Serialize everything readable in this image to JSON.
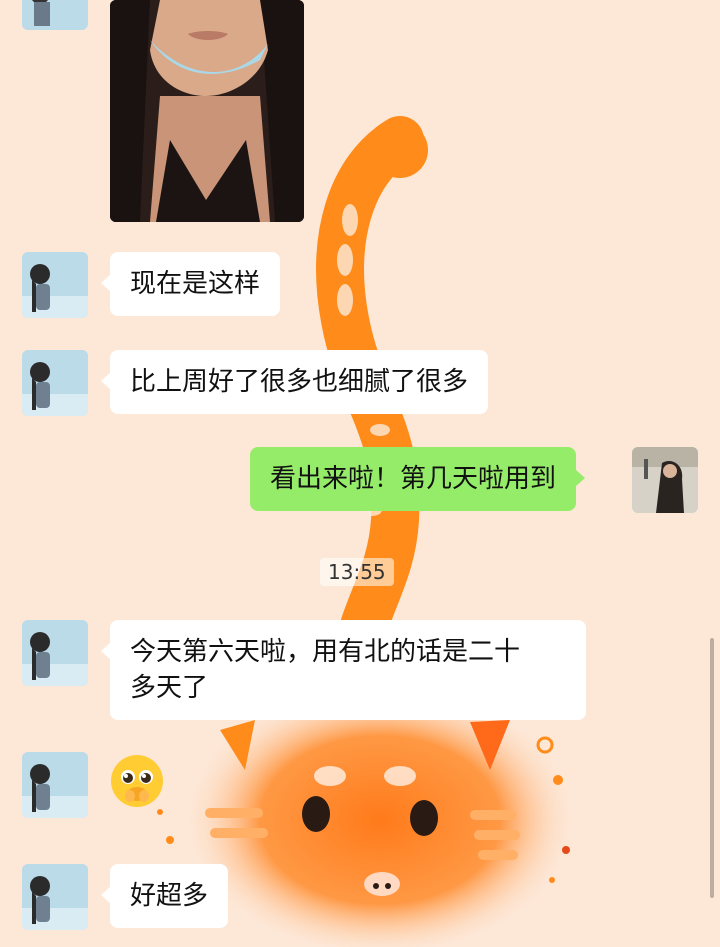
{
  "colors": {
    "background": "#fde8d8",
    "incoming_bubble": "#ffffff",
    "outgoing_bubble": "#95ec69",
    "wallpaper_accent": "#ff8c1a"
  },
  "messages": [
    {
      "type": "image",
      "direction": "incoming",
      "description": "selfie-photo"
    },
    {
      "type": "text",
      "direction": "incoming",
      "text": "现在是这样"
    },
    {
      "type": "text",
      "direction": "incoming",
      "text": "比上周好了很多也细腻了很多"
    },
    {
      "type": "text",
      "direction": "outgoing",
      "text": "看出来啦！第几天啦用到"
    },
    {
      "type": "text",
      "direction": "incoming",
      "text_line1": "今天第六天啦，用有北的话是二十",
      "text_line2": "多天了"
    },
    {
      "type": "emoji",
      "direction": "incoming",
      "icon": "pleading-face-emoji"
    },
    {
      "type": "text",
      "direction": "incoming",
      "text": "好超多"
    }
  ],
  "timestamp": "13:55",
  "wallpaper": {
    "icon": "orange-cat-wallpaper"
  }
}
